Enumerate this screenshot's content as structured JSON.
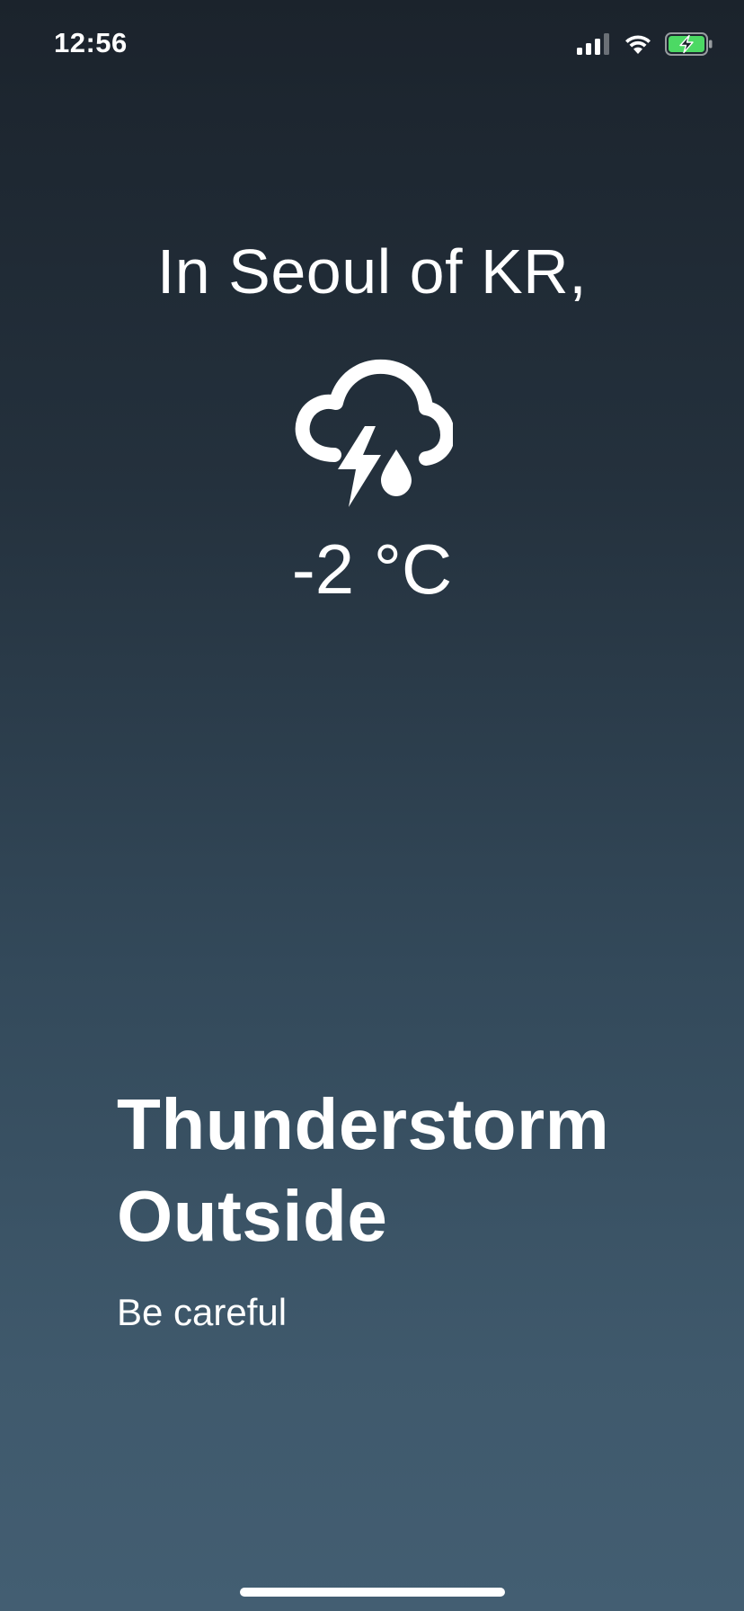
{
  "status_bar": {
    "time": "12:56",
    "icons": [
      "cellular-signal-icon",
      "wifi-icon",
      "battery-charging-icon"
    ],
    "battery_color": "#4cd964"
  },
  "weather": {
    "location_heading": "In Seoul of KR,",
    "condition_icon": "thunderstorm-rain-icon",
    "temperature": "-2 °C",
    "condition_line1": "Thunderstorm",
    "condition_line2": "Outside",
    "message": "Be careful"
  },
  "theme": {
    "gradient_top": "#1b232c",
    "gradient_bottom": "#435e72",
    "text_color": "#ffffff"
  }
}
